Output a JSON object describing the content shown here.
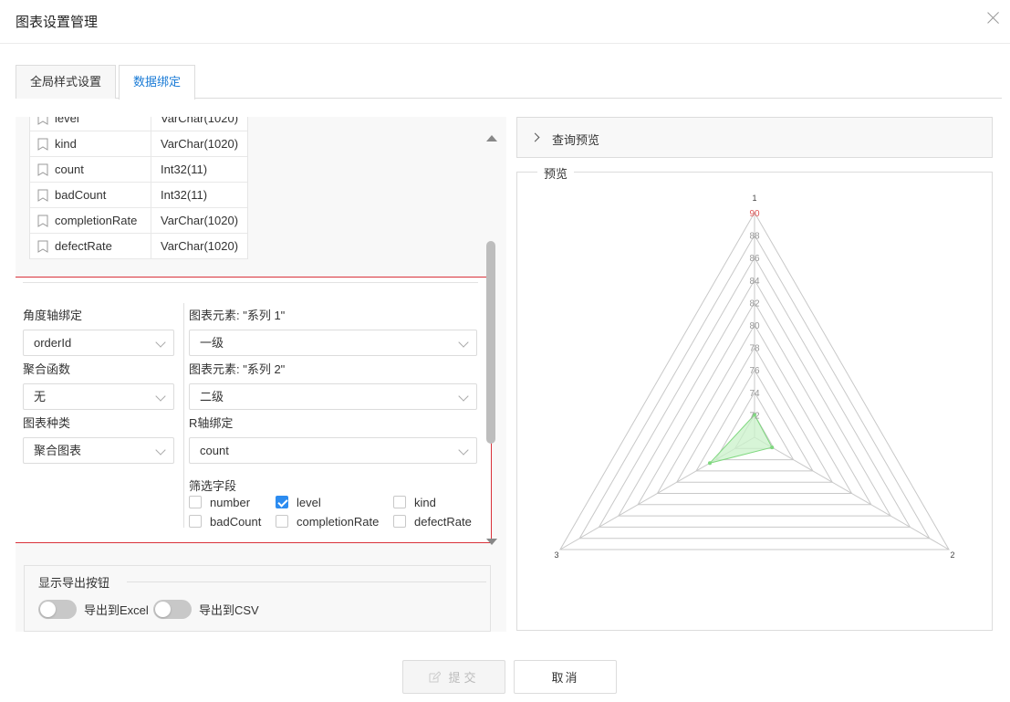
{
  "dialog": {
    "title": "图表设置管理"
  },
  "tabs": [
    {
      "label": "全局样式设置",
      "active": false
    },
    {
      "label": "数据绑定",
      "active": true
    }
  ],
  "fields": [
    {
      "name": "level",
      "type": "VarChar(1020)"
    },
    {
      "name": "kind",
      "type": "VarChar(1020)"
    },
    {
      "name": "count",
      "type": "Int32(11)"
    },
    {
      "name": "badCount",
      "type": "Int32(11)"
    },
    {
      "name": "completionRate",
      "type": "VarChar(1020)"
    },
    {
      "name": "defectRate",
      "type": "VarChar(1020)"
    }
  ],
  "binding": {
    "angle_axis_label": "角度轴绑定",
    "angle_axis_value": "orderId",
    "agg_func_label": "聚合函数",
    "agg_func_value": "无",
    "chart_kind_label": "图表种类",
    "chart_kind_value": "聚合图表",
    "series1_label": "图表元素: \"系列 1\"",
    "series1_value": "一级",
    "series2_label": "图表元素: \"系列 2\"",
    "series2_value": "二级",
    "r_axis_label": "R轴绑定",
    "r_axis_value": "count",
    "filter_label": "筛选字段",
    "filters": [
      {
        "label": "number",
        "checked": false
      },
      {
        "label": "level",
        "checked": true
      },
      {
        "label": "kind",
        "checked": false
      },
      {
        "label": "badCount",
        "checked": false
      },
      {
        "label": "completionRate",
        "checked": false
      },
      {
        "label": "defectRate",
        "checked": false
      }
    ]
  },
  "export": {
    "title": "显示导出按钮",
    "excel_label": "导出到Excel",
    "excel_on": false,
    "csv_label": "导出到CSV",
    "csv_on": false
  },
  "query_preview": {
    "label": "查询预览"
  },
  "preview": {
    "label": "预览"
  },
  "chart_data": {
    "type": "radar",
    "indicators": [
      "1",
      "2",
      "3"
    ],
    "radial_ticks": [
      "90",
      "88",
      "86",
      "84",
      "82",
      "80",
      "78",
      "76",
      "74",
      "72"
    ],
    "rmin": 70,
    "rmax": 90,
    "series_values": [
      72.0,
      71.8,
      74.6
    ],
    "colors": {
      "grid": "#c8c8c8",
      "area_fill": "#c9f2c9",
      "area_stroke": "#7fd87f",
      "tick_text": "#999999",
      "tick_top": "#e05656"
    }
  },
  "buttons": {
    "submit_label": "提交",
    "cancel_label": "取消"
  }
}
